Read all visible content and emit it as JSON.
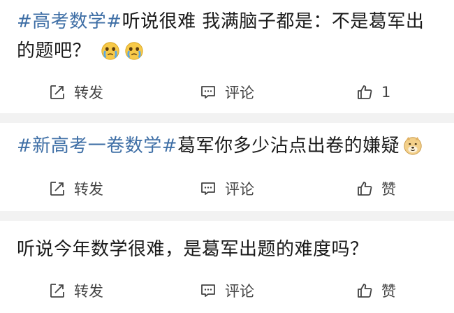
{
  "posts": [
    {
      "hashtag": "#高考数学#",
      "text": "听说很难 我满脑子都是：不是葛军出的题吧？",
      "emoji": [
        "crying-face-icon",
        "crying-face-icon"
      ],
      "actions": {
        "repost": "转发",
        "comment": "评论",
        "like": "1"
      }
    },
    {
      "hashtag": "#新高考一卷数学#",
      "text": "葛军你多少沾点出卷的嫌疑",
      "emoji": [
        "doge-icon"
      ],
      "actions": {
        "repost": "转发",
        "comment": "评论",
        "like": "赞"
      }
    },
    {
      "hashtag": "",
      "text": "听说今年数学很难，是葛军出题的难度吗？",
      "emoji": [],
      "actions": {
        "repost": "转发",
        "comment": "评论",
        "like": "赞"
      }
    }
  ],
  "colors": {
    "hashtag": "#3f6fa6",
    "text": "#1a1a1a",
    "action": "#444444",
    "separator": "#f2f2f2"
  }
}
